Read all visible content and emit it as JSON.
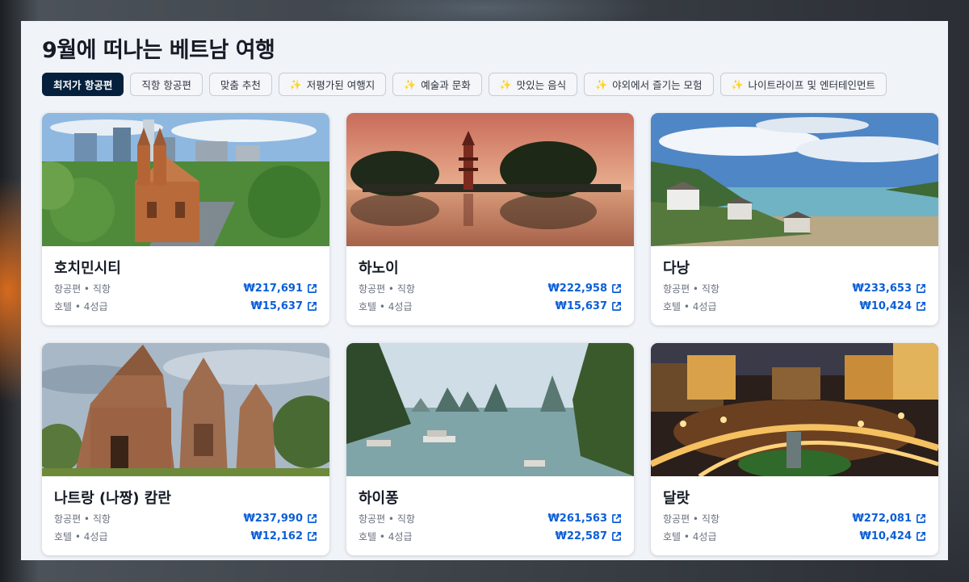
{
  "page": {
    "title": "9월에 떠나는 베트남 여행"
  },
  "tabs": [
    {
      "label": "최저가 항공편",
      "active": true,
      "sparkle": false
    },
    {
      "label": "직항 항공편",
      "active": false,
      "sparkle": false
    },
    {
      "label": "맞춤 추천",
      "active": false,
      "sparkle": false
    },
    {
      "label": "저평가된 여행지",
      "active": false,
      "sparkle": true
    },
    {
      "label": "예술과 문화",
      "active": false,
      "sparkle": true
    },
    {
      "label": "맛있는 음식",
      "active": false,
      "sparkle": true
    },
    {
      "label": "야외에서 즐기는 모험",
      "active": false,
      "sparkle": true
    },
    {
      "label": "나이트라이프 및 엔터테인먼트",
      "active": false,
      "sparkle": true
    }
  ],
  "sparkle_glyph": "✨",
  "cards": [
    {
      "city": "호치민시티",
      "flight_label": "항공편 • 직항",
      "flight_price": "₩217,691",
      "hotel_label": "호텔 • 4성급",
      "hotel_price": "₩15,637",
      "photo": "cathedral-city"
    },
    {
      "city": "하노이",
      "flight_label": "항공편 • 직항",
      "flight_price": "₩222,958",
      "hotel_label": "호텔 • 4성급",
      "hotel_price": "₩15,637",
      "photo": "pagoda-lake"
    },
    {
      "city": "다낭",
      "flight_label": "항공편 • 직항",
      "flight_price": "₩233,653",
      "hotel_label": "호텔 • 4성급",
      "hotel_price": "₩10,424",
      "photo": "coastal-villas"
    },
    {
      "city": "나트랑 (나짱) 캄란",
      "flight_label": "항공편 • 직항",
      "flight_price": "₩237,990",
      "hotel_label": "호텔 • 4성급",
      "hotel_price": "₩12,162",
      "photo": "cham-towers"
    },
    {
      "city": "하이퐁",
      "flight_label": "항공편 • 직항",
      "flight_price": "₩261,563",
      "hotel_label": "호텔 • 4성급",
      "hotel_price": "₩22,587",
      "photo": "ha-long-bay"
    },
    {
      "city": "달랏",
      "flight_label": "항공편 • 직항",
      "flight_price": "₩272,081",
      "hotel_label": "호텔 • 4성급",
      "hotel_price": "₩10,424",
      "photo": "city-night"
    }
  ],
  "colors": {
    "accent": "#0b5ed7",
    "active_tab": "#05203c",
    "panel": "#f0f3f7"
  },
  "icons": {
    "external_link": "external-link-icon",
    "sparkle": "sparkle-icon"
  }
}
